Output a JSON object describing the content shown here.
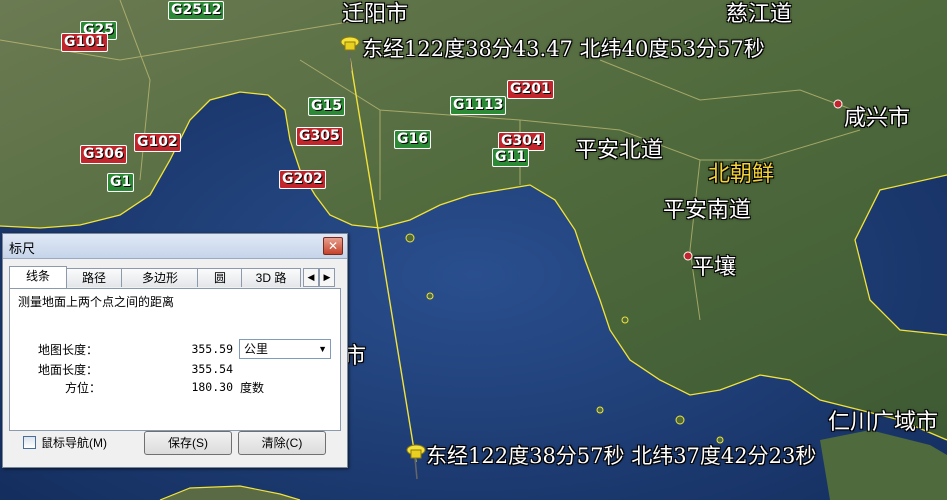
{
  "map": {
    "places": [
      {
        "name": "迁阳市",
        "style": "white"
      },
      {
        "name": "慈江道",
        "style": "white"
      },
      {
        "name": "咸兴市",
        "style": "white"
      },
      {
        "name": "平安北道",
        "style": "white"
      },
      {
        "name": "北朝鲜",
        "style": "yellow"
      },
      {
        "name": "平安南道",
        "style": "white"
      },
      {
        "name": "平壤",
        "style": "white"
      },
      {
        "name": "仁川广域市",
        "style": "white"
      },
      {
        "name": "市",
        "style": "white"
      }
    ],
    "coordinates": {
      "start": "东经122度38分43.47 北纬40度53分57秒",
      "end": "东经122度38分57秒 北纬37度42分23秒"
    },
    "road_shields": [
      {
        "text": "G25",
        "color": "green"
      },
      {
        "text": "G2512",
        "color": "green"
      },
      {
        "text": "G101",
        "color": "red"
      },
      {
        "text": "G15",
        "color": "green"
      },
      {
        "text": "G1113",
        "color": "green"
      },
      {
        "text": "G201",
        "color": "red"
      },
      {
        "text": "G102",
        "color": "red"
      },
      {
        "text": "G305",
        "color": "red"
      },
      {
        "text": "G16",
        "color": "green"
      },
      {
        "text": "G304",
        "color": "red"
      },
      {
        "text": "G306",
        "color": "red"
      },
      {
        "text": "G11",
        "color": "green"
      },
      {
        "text": "G1",
        "color": "green"
      },
      {
        "text": "G202",
        "color": "red"
      }
    ],
    "colors": {
      "sea": "#1d3f7a",
      "land": "#5b6f45",
      "coastline": "#f2e23a",
      "measure_line": "#f2e23a",
      "road_red": "#c3252c",
      "road_green": "#2c8a36"
    }
  },
  "ruler": {
    "title": "标尺",
    "close_icon": "close-icon",
    "tabs": [
      "线条",
      "路径",
      "多边形",
      "圆",
      "3D 路"
    ],
    "active_tab": "线条",
    "description": "测量地面上两个点之间的距离",
    "map_length_label": "地图长度：",
    "map_length_value": "355.59",
    "unit_selected": "公里",
    "ground_length_label": "地面长度：",
    "ground_length_value": "355.54",
    "heading_label": "方位：",
    "heading_value": "180.30",
    "heading_unit": "度数",
    "mouse_nav_label": "鼠标导航(M)",
    "save_label": "保存(S)",
    "clear_label": "清除(C)"
  }
}
